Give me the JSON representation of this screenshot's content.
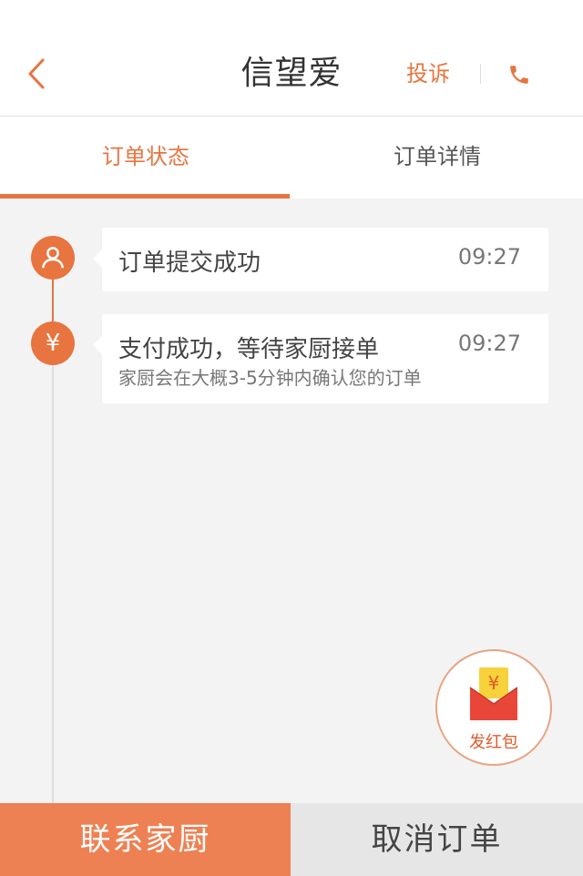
{
  "header": {
    "title": "信望爱",
    "complain_label": "投诉",
    "back_icon": "chevron-left-icon",
    "phone_icon": "phone-icon"
  },
  "tabs": [
    {
      "label": "订单状态",
      "active": true
    },
    {
      "label": "订单详情",
      "active": false
    }
  ],
  "timeline": [
    {
      "icon": "user-icon",
      "title": "订单提交成功",
      "time": "09:27",
      "subtitle": ""
    },
    {
      "icon": "yen-icon",
      "title": "支付成功，等待家厨接单",
      "time": "09:27",
      "subtitle": "家厨会在大概3-5分钟内确认您的订单"
    }
  ],
  "red_packet": {
    "label": "发红包",
    "icon": "red-envelope-icon"
  },
  "actions": {
    "contact": "联系家厨",
    "cancel": "取消订单"
  },
  "colors": {
    "accent": "#e8743f",
    "contact_bg": "#ee8154",
    "cancel_bg": "#e6e6e6",
    "page_bg": "#f3f3f3"
  }
}
